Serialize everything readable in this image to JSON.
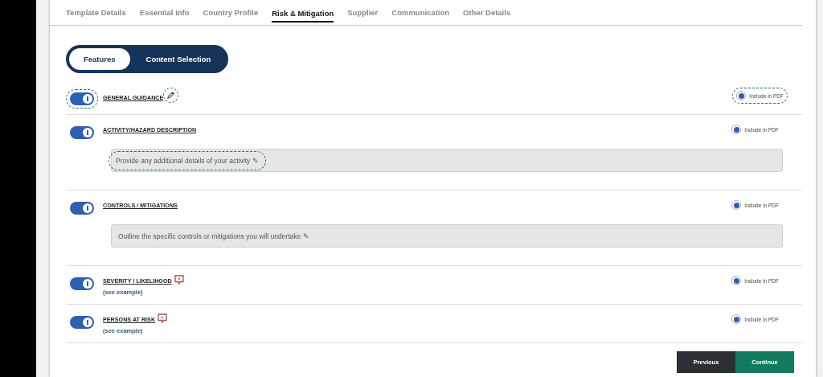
{
  "tabs": [
    {
      "label": "Template Details",
      "selected": false
    },
    {
      "label": "Essential Info",
      "selected": false
    },
    {
      "label": "Country Profile",
      "selected": false
    },
    {
      "label": "Risk & Mitigation",
      "selected": true
    },
    {
      "label": "Supplier",
      "selected": false
    },
    {
      "label": "Communication",
      "selected": false
    },
    {
      "label": "Other Details",
      "selected": false
    }
  ],
  "segments": [
    {
      "label": "Features",
      "selected": true
    },
    {
      "label": "Content Selection",
      "selected": false
    }
  ],
  "features": [
    {
      "title": "GENERAL GUIDANCE",
      "kind": "guidance",
      "on": true,
      "toggle_highlighted": true,
      "icon_highlighted": true,
      "pdf_label": "Include in PDF",
      "pdf": true,
      "pdf_highlighted": true
    },
    {
      "title": "ACTIVITY/HAZARD DESCRIPTION",
      "kind": "field",
      "on": true,
      "toggle_highlighted": false,
      "pdf_label": "Include in PDF",
      "pdf": true,
      "pdf_highlighted": false,
      "field": {
        "placeholder": "Provide any additional details of your activity ✎",
        "highlighted": true
      }
    },
    {
      "title": "CONTROLS / MITIGATIONS",
      "kind": "field",
      "on": true,
      "toggle_highlighted": false,
      "pdf_label": "Include in PDF",
      "pdf": true,
      "pdf_highlighted": false,
      "field": {
        "placeholder": "Outline the specific controls or mitigations you will undertake ✎",
        "highlighted": false
      }
    },
    {
      "title": "SEVERITY / LIKELIHOOD",
      "kind": "example",
      "on": true,
      "toggle_highlighted": false,
      "link": "(see example)",
      "pdf_label": "Include in PDF",
      "pdf": true,
      "pdf_highlighted": false
    },
    {
      "title": "PERSONS AT RISK",
      "kind": "example",
      "on": true,
      "toggle_highlighted": false,
      "link": "(see example)",
      "pdf_label": "Include in PDF",
      "pdf": true,
      "pdf_highlighted": false
    }
  ],
  "buttons": [
    {
      "label": "Previous",
      "kind": "secondary"
    },
    {
      "label": "Continue",
      "kind": "primary"
    }
  ]
}
